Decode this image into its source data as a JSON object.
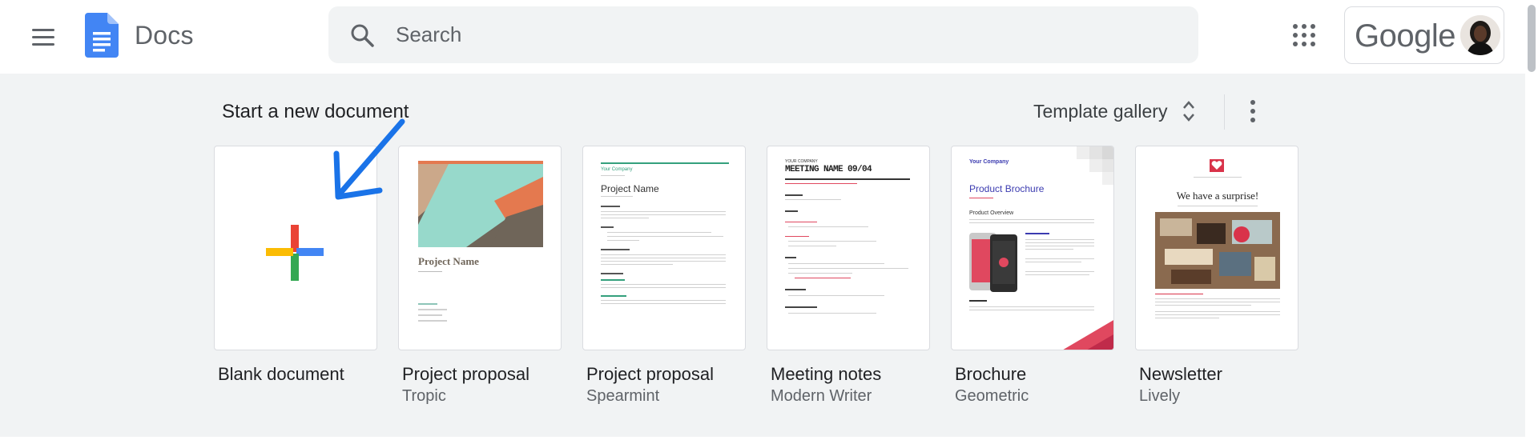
{
  "header": {
    "app_title": "Docs",
    "search_placeholder": "Search",
    "account_brand": "Google"
  },
  "templates": {
    "section_title": "Start a new document",
    "gallery_label": "Template gallery",
    "items": [
      {
        "name": "Blank document",
        "theme": ""
      },
      {
        "name": "Project proposal",
        "theme": "Tropic"
      },
      {
        "name": "Project proposal",
        "theme": "Spearmint"
      },
      {
        "name": "Meeting notes",
        "theme": "Modern Writer"
      },
      {
        "name": "Brochure",
        "theme": "Geometric"
      },
      {
        "name": "Newsletter",
        "theme": "Lively"
      }
    ]
  },
  "thumbnails": {
    "tropic_title": "Project Name",
    "spearmint_company": "Your Company",
    "spearmint_title": "Project Name",
    "meeting_company": "YOUR COMPANY",
    "meeting_title": "MEETING NAME 09/04",
    "brochure_company": "Your Company",
    "brochure_title": "Product Brochure",
    "brochure_subtitle": "Product Overview",
    "newsletter_title": "We have a surprise!"
  },
  "colors": {
    "accent_blue": "#1a73e8",
    "docs_blue": "#4285f4",
    "annotation_arrow": "#1a73e8"
  },
  "icons": [
    "menu-icon",
    "docs-logo-icon",
    "search-icon",
    "apps-grid-icon",
    "unfold-icon",
    "more-vert-icon",
    "plus-icon"
  ]
}
